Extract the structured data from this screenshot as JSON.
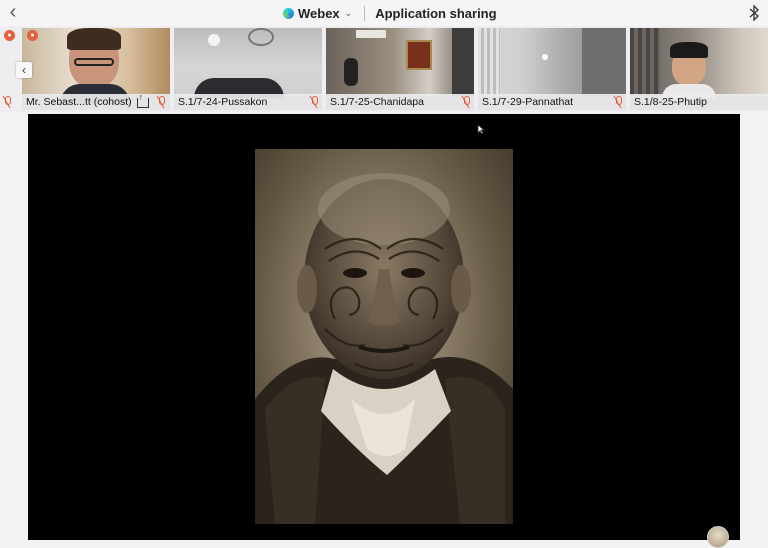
{
  "header": {
    "app_name": "Webex",
    "title": "Application sharing"
  },
  "participants": [
    {
      "name": "Mr. Sebast...tt (cohost)"
    },
    {
      "name": "S.1/7-24-Pussakon"
    },
    {
      "name": "S.1/7-25-Chanidapa"
    },
    {
      "name": "S.1/7-29-Pannathat"
    },
    {
      "name": "S.1/8-25-Phutip"
    }
  ],
  "colors": {
    "accent": "#e5603d",
    "share_background": "#000000"
  },
  "icons": {
    "back": "chevron-left-icon",
    "bluetooth": "bluetooth-icon",
    "mic_muted": "mic-muted-icon",
    "share": "share-icon"
  }
}
